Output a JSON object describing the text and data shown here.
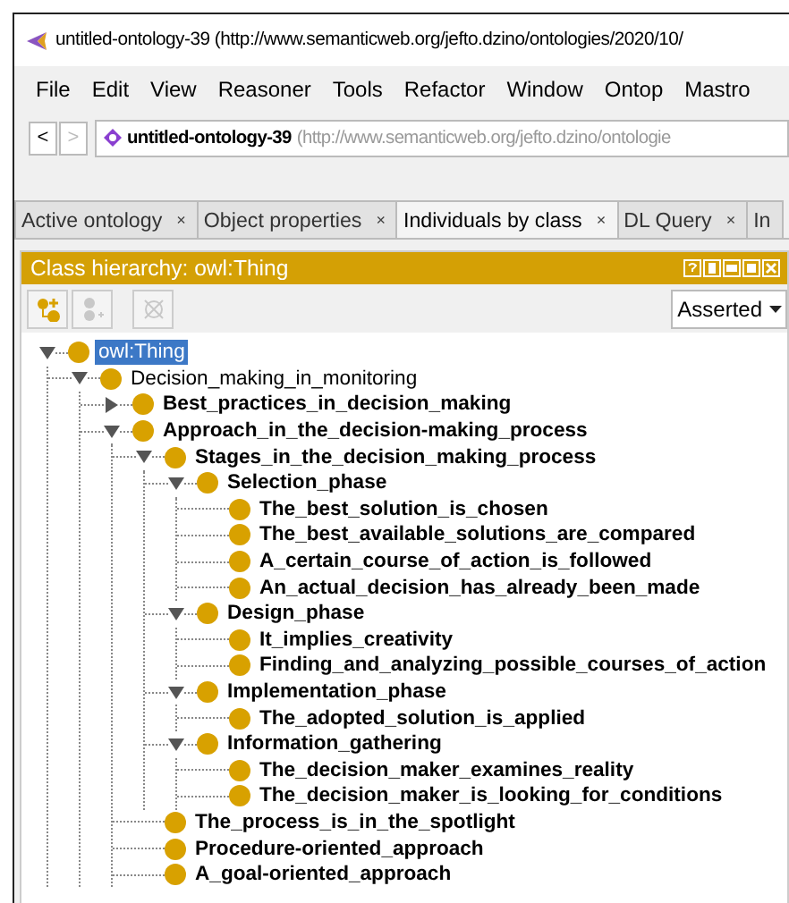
{
  "window": {
    "title": "untitled-ontology-39 (http://www.semanticweb.org/jefto.dzino/ontologies/2020/10/"
  },
  "menu": [
    "File",
    "Edit",
    "View",
    "Reasoner",
    "Tools",
    "Refactor",
    "Window",
    "Ontop",
    "Mastro"
  ],
  "nav": {
    "back": "<",
    "forward": ">",
    "forward_disabled": true,
    "ontology": "untitled-ontology-39",
    "iri": "(http://www.semanticweb.org/jefto.dzino/ontologie"
  },
  "tabs": [
    {
      "label": "Active ontology",
      "close": "×",
      "selected": false
    },
    {
      "label": "Object properties",
      "close": "×",
      "selected": false
    },
    {
      "label": "Individuals by class",
      "close": "×",
      "selected": true
    },
    {
      "label": "DL Query",
      "close": "×",
      "selected": false
    },
    {
      "label": "In",
      "selected": false
    }
  ],
  "panel": {
    "title": "Class hierarchy: owl:Thing",
    "toolbar": [
      {
        "kind": "add-subclass",
        "disabled": false
      },
      {
        "kind": "add-sibling",
        "disabled": true
      },
      {
        "kind": "delete",
        "disabled": true
      }
    ],
    "mode": "Asserted"
  },
  "tree": [
    {
      "label": "owl:Thing",
      "bold": false,
      "selected": true,
      "expanded": true,
      "children": [
        {
          "label": "Decision_making_in_monitoring",
          "bold": false,
          "selected": false,
          "expanded": true,
          "children": [
            {
              "label": "Best_practices_in_decision_making",
              "bold": true,
              "selected": false,
              "expanded": false
            },
            {
              "label": "Approach_in_the_decision-making_process",
              "bold": true,
              "selected": false,
              "expanded": true,
              "children": [
                {
                  "label": "Stages_in_the_decision_making_process",
                  "bold": true,
                  "selected": false,
                  "expanded": true,
                  "children": [
                    {
                      "label": "Selection_phase",
                      "bold": true,
                      "selected": false,
                      "expanded": true,
                      "children": [
                        {
                          "label": "The_best_solution_is_chosen",
                          "bold": true,
                          "selected": false
                        },
                        {
                          "label": "The_best_available_solutions_are_compared",
                          "bold": true,
                          "selected": false
                        },
                        {
                          "label": "A_certain_course_of_action_is_followed",
                          "bold": true,
                          "selected": false
                        },
                        {
                          "label": "An_actual_decision_has_already_been_made",
                          "bold": true,
                          "selected": false
                        }
                      ]
                    },
                    {
                      "label": "Design_phase",
                      "bold": true,
                      "selected": false,
                      "expanded": true,
                      "children": [
                        {
                          "label": "It_implies_creativity",
                          "bold": true,
                          "selected": false
                        },
                        {
                          "label": "Finding_and_analyzing_possible_courses_of_action",
                          "bold": true,
                          "selected": false
                        }
                      ]
                    },
                    {
                      "label": "Implementation_phase",
                      "bold": true,
                      "selected": false,
                      "expanded": true,
                      "children": [
                        {
                          "label": "The_adopted_solution_is_applied",
                          "bold": true,
                          "selected": false
                        }
                      ]
                    },
                    {
                      "label": "Information_gathering",
                      "bold": true,
                      "selected": false,
                      "expanded": true,
                      "children": [
                        {
                          "label": "The_decision_maker_examines_reality",
                          "bold": true,
                          "selected": false
                        },
                        {
                          "label": "The_decision_maker_is_looking_for_conditions",
                          "bold": true,
                          "selected": false
                        }
                      ]
                    }
                  ]
                },
                {
                  "label": "The_process_is_in_the_spotlight",
                  "bold": true,
                  "selected": false
                },
                {
                  "label": "Procedure-oriented_approach",
                  "bold": true,
                  "selected": false
                },
                {
                  "label": "A_goal-oriented_approach",
                  "bold": true,
                  "selected": false
                }
              ]
            }
          ]
        }
      ]
    }
  ]
}
